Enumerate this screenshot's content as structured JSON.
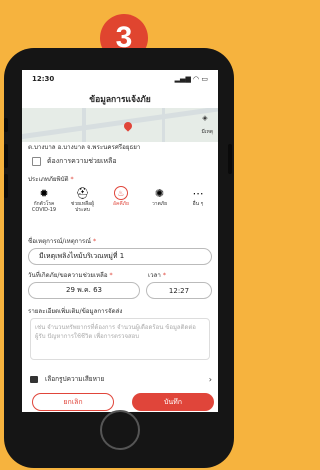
{
  "step_badge": "3",
  "status_bar": {
    "time": "12:30",
    "icons": "signal-wifi-battery"
  },
  "header": {
    "title": "ข้อมูลการแจ้งภัย"
  },
  "map": {
    "address": "ต.บางบาล อ.บางบาล จ.พระนครศรีอยุธยา",
    "compass_label": "มีเหตุ"
  },
  "need_help": {
    "label": "ต้องการความช่วยเหลือ"
  },
  "disaster_type": {
    "label": "ประเภทภัยพิบัติ",
    "items": [
      {
        "label": "กักตัวโรค COVID-19",
        "icon": "virus-icon",
        "selected": false
      },
      {
        "label": "ช่วยเหลือผู้ประสบ",
        "icon": "rescue-icon",
        "selected": false
      },
      {
        "label": "อัคคีภัย",
        "icon": "fire-icon",
        "selected": true
      },
      {
        "label": "วาตภัย",
        "icon": "storm-icon",
        "selected": false
      },
      {
        "label": "อื่น ๆ",
        "icon": "more-icon",
        "selected": false
      }
    ]
  },
  "event_name": {
    "label": "ชื่อเหตุการณ์/เหตุการณ์",
    "value": "มีเหตุเพลิงไหม้บริเวณหมู่ที่ 1"
  },
  "date_field": {
    "label": "วันที่เกิดภัย/ขอความช่วยเหลือ",
    "value": "29 พ.ค. 63"
  },
  "time_field": {
    "label": "เวลา",
    "value": "12:27"
  },
  "details": {
    "label": "รายละเอียดเพิ่มเติม/ข้อมูลการจัดส่ง",
    "placeholder": "เช่น จำนวนทรัพยากรที่ต้องการ จำนวนผู้เดือดร้อน ข้อมูลติดต่อผู้รับ ปัญหาการใช้ชีวิต เพื่อการตรวจสอบ"
  },
  "media": {
    "label": "เลือกรูปความเสียหาย"
  },
  "buttons": {
    "cancel": "ยกเลิก",
    "save": "บันทึก"
  }
}
